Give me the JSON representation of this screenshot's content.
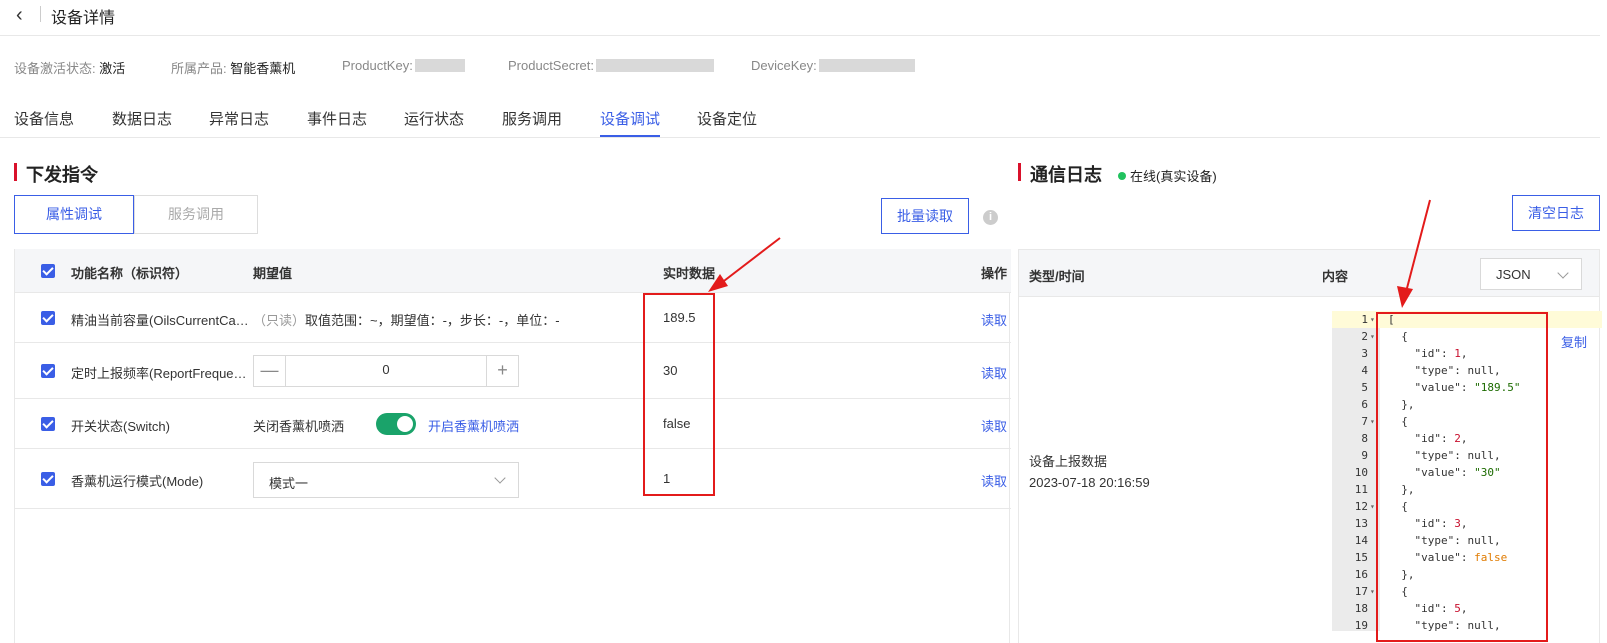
{
  "header": {
    "back_icon": "chevron-left-icon",
    "title": "设备详情"
  },
  "meta": {
    "activation_label": "设备激活状态:",
    "activation_value": "激活",
    "product_label": "所属产品:",
    "product_value": "智能香薰机",
    "product_key_label": "ProductKey:",
    "product_secret_label": "ProductSecret:",
    "device_key_label": "DeviceKey:"
  },
  "tabs": [
    {
      "label": "设备信息"
    },
    {
      "label": "数据日志"
    },
    {
      "label": "异常日志"
    },
    {
      "label": "事件日志"
    },
    {
      "label": "运行状态"
    },
    {
      "label": "服务调用"
    },
    {
      "label": "设备调试",
      "active": true
    },
    {
      "label": "设备定位"
    }
  ],
  "left": {
    "title": "下发指令",
    "seg_property": "属性调试",
    "seg_service": "服务调用",
    "batch_read": "批量读取",
    "info_icon": "i",
    "columns": {
      "name": "功能名称（标识符）",
      "expected": "期望值",
      "realtime": "实时数据",
      "action": "操作"
    },
    "rows": [
      {
        "name": "精油当前容量(OilsCurrentCa…",
        "expected_readonly": "（只读）",
        "expected_desc": "取值范围：~，期望值：-，步长：-，单位：-",
        "realtime": "189.5",
        "action": "读取"
      },
      {
        "name": "定时上报频率(ReportFreque…",
        "stepper_minus": "—",
        "stepper_value": "0",
        "stepper_plus": "+",
        "realtime": "30",
        "action": "读取"
      },
      {
        "name": "开关状态(Switch)",
        "toggle_off_label": "关闭香薰机喷洒",
        "toggle_on_label": "开启香薰机喷洒",
        "realtime": "false",
        "action": "读取"
      },
      {
        "name": "香薰机运行模式(Mode)",
        "select_value": "模式一",
        "realtime": "1",
        "action": "读取"
      }
    ]
  },
  "right": {
    "title": "通信日志",
    "status": "在线(真实设备)",
    "status_color": "#21c25e",
    "clear_btn": "清空日志",
    "columns": {
      "type_time": "类型/时间",
      "content": "内容"
    },
    "format": "JSON",
    "entry_type": "设备上报数据",
    "entry_time": "2023-07-18 20:16:59",
    "copy": "复制",
    "code_lines": [
      {
        "n": "1",
        "fold": true,
        "text": "["
      },
      {
        "n": "2",
        "fold": true,
        "text": "  {"
      },
      {
        "n": "3",
        "text": "    \"id\": ",
        "num": "1",
        "tail": ","
      },
      {
        "n": "4",
        "text": "    \"type\": ",
        "nul": "null",
        "tail": ","
      },
      {
        "n": "5",
        "text": "    \"value\": ",
        "str": "\"189.5\""
      },
      {
        "n": "6",
        "text": "  },"
      },
      {
        "n": "7",
        "fold": true,
        "text": "  {"
      },
      {
        "n": "8",
        "text": "    \"id\": ",
        "num": "2",
        "tail": ","
      },
      {
        "n": "9",
        "text": "    \"type\": ",
        "nul": "null",
        "tail": ","
      },
      {
        "n": "10",
        "text": "    \"value\": ",
        "str": "\"30\""
      },
      {
        "n": "11",
        "text": "  },"
      },
      {
        "n": "12",
        "fold": true,
        "text": "  {"
      },
      {
        "n": "13",
        "text": "    \"id\": ",
        "num": "3",
        "tail": ","
      },
      {
        "n": "14",
        "text": "    \"type\": ",
        "nul": "null",
        "tail": ","
      },
      {
        "n": "15",
        "text": "    \"value\": ",
        "bool": "false"
      },
      {
        "n": "16",
        "text": "  },"
      },
      {
        "n": "17",
        "fold": true,
        "text": "  {"
      },
      {
        "n": "18",
        "text": "    \"id\": ",
        "num": "5",
        "tail": ","
      },
      {
        "n": "19",
        "text": "    \"type\": ",
        "nul": "null",
        "tail": ","
      }
    ]
  },
  "colors": {
    "accent": "#3a5ee6",
    "section_bar": "#d9112b",
    "annotation_red": "#e31b1b",
    "toggle_on": "#1aa36a"
  }
}
